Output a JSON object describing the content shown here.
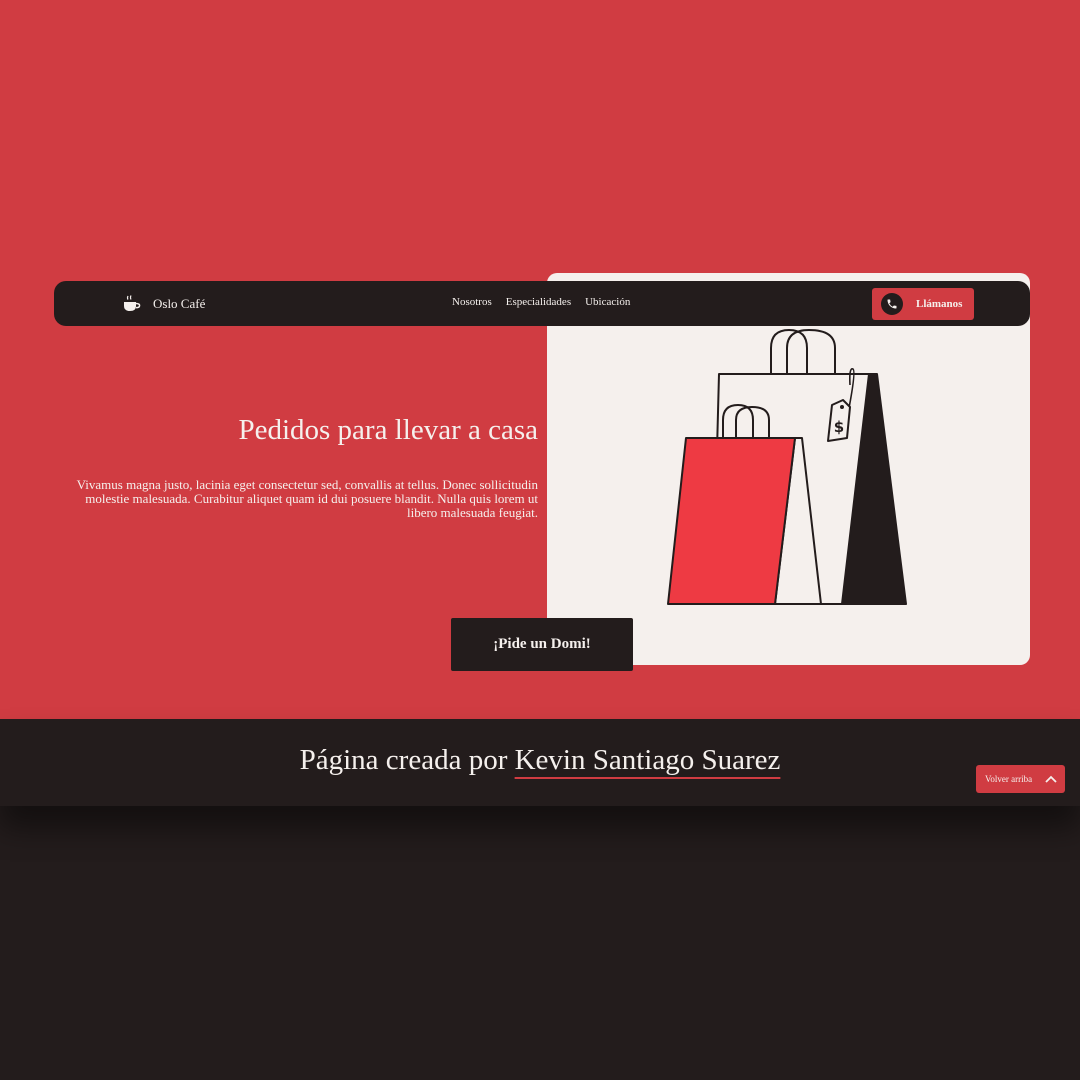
{
  "colors": {
    "accent": "#d03c42",
    "dark": "#231c1c",
    "light": "#f5f0ed",
    "bag_red": "#ee3a43"
  },
  "navbar": {
    "brand": {
      "icon": "coffee-cup-icon",
      "name": "Oslo Café"
    },
    "links": [
      "Nosotros",
      "Especialidades",
      "Ubicación"
    ],
    "call_button": {
      "icon": "phone-icon",
      "label": "Llámanos"
    }
  },
  "hero": {
    "title": "Pedidos para llevar a casa",
    "description": "Vivamus magna justo, lacinia eget consectetur sed, convallis at tellus. Donec sollicitudin molestie malesuada. Curabitur aliquet quam id dui posuere blandit. Nulla quis lorem ut libero malesuada feugiat.",
    "cta_label": "¡Pide un Domi!",
    "illustration": {
      "icon": "shopping-bags-icon",
      "price_tag_text": "$"
    }
  },
  "footer": {
    "credit_prefix": "Página creada por ",
    "credit_author": "Kevin Santiago Suarez",
    "back_to_top": {
      "label": "Volver arriba",
      "icon": "chevron-up-icon"
    }
  }
}
